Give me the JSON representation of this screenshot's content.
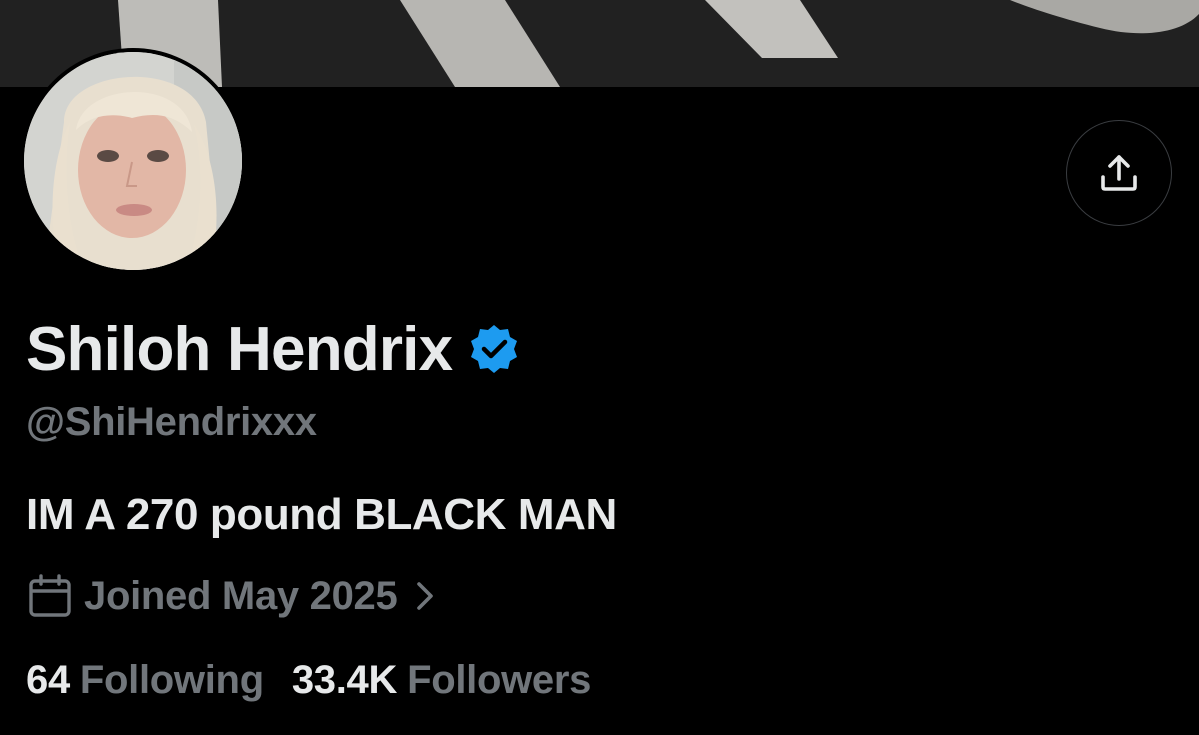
{
  "profile": {
    "display_name": "Shiloh Hendrix",
    "verified": true,
    "handle": "@ShiHendrixxx",
    "bio": "IM A 270 pound BLACK MAN",
    "joined": "Joined May 2025"
  },
  "stats": {
    "following_count": "64",
    "following_label": "Following",
    "followers_count": "33.4K",
    "followers_label": "Followers"
  },
  "icons": {
    "share": "share-upload-icon",
    "verified": "verified-badge-icon",
    "calendar": "calendar-icon",
    "chevron": "chevron-right-icon"
  },
  "colors": {
    "background": "#000000",
    "primary_text": "#e7e9ea",
    "secondary_text": "#71767b",
    "verified_blue": "#1d9bf0",
    "border": "#3a3d41"
  }
}
